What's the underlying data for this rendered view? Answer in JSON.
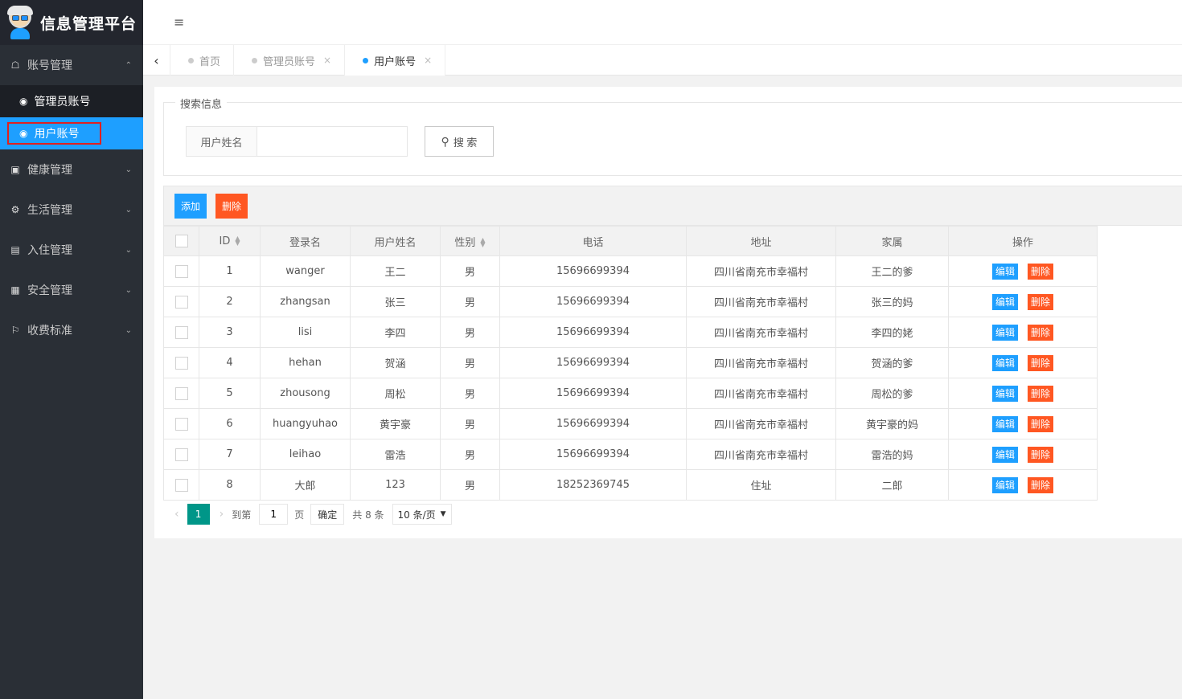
{
  "app": {
    "title": "信息管理平台"
  },
  "sidebar": {
    "groups": [
      {
        "label": "账号管理",
        "icon": "home-icon",
        "expanded": true
      },
      {
        "label": "健康管理",
        "icon": "window-icon"
      },
      {
        "label": "生活管理",
        "icon": "gears-icon"
      },
      {
        "label": "入住管理",
        "icon": "file-icon"
      },
      {
        "label": "安全管理",
        "icon": "calendar-icon"
      },
      {
        "label": "收费标准",
        "icon": "flag-icon"
      }
    ],
    "sub_items": [
      {
        "label": "管理员账号",
        "icon": "dashboard-icon"
      },
      {
        "label": "用户账号",
        "icon": "dashboard-icon",
        "active": true
      }
    ]
  },
  "tabs": [
    {
      "label": "首页"
    },
    {
      "label": "管理员账号",
      "close": "×"
    },
    {
      "label": "用户账号",
      "close": "×",
      "active": true
    }
  ],
  "search": {
    "legend": "搜索信息",
    "label": "用户姓名",
    "value": "",
    "button": "搜 索"
  },
  "toolbar": {
    "add": "添加",
    "delete": "删除"
  },
  "table": {
    "headers": [
      "ID",
      "登录名",
      "用户姓名",
      "性别",
      "电话",
      "地址",
      "家属",
      "操作"
    ],
    "edit_label": "编辑",
    "delete_label": "删除",
    "rows": [
      {
        "id": "1",
        "login": "wanger",
        "name": "王二",
        "gender": "男",
        "phone": "15696699394",
        "address": "四川省南充市幸福村",
        "family": "王二的爹"
      },
      {
        "id": "2",
        "login": "zhangsan",
        "name": "张三",
        "gender": "男",
        "phone": "15696699394",
        "address": "四川省南充市幸福村",
        "family": "张三的妈"
      },
      {
        "id": "3",
        "login": "lisi",
        "name": "李四",
        "gender": "男",
        "phone": "15696699394",
        "address": "四川省南充市幸福村",
        "family": "李四的姥"
      },
      {
        "id": "4",
        "login": "hehan",
        "name": "贺涵",
        "gender": "男",
        "phone": "15696699394",
        "address": "四川省南充市幸福村",
        "family": "贺涵的爹"
      },
      {
        "id": "5",
        "login": "zhousong",
        "name": "周松",
        "gender": "男",
        "phone": "15696699394",
        "address": "四川省南充市幸福村",
        "family": "周松的爹"
      },
      {
        "id": "6",
        "login": "huangyuhao",
        "name": "黄宇豪",
        "gender": "男",
        "phone": "15696699394",
        "address": "四川省南充市幸福村",
        "family": "黄宇豪的妈"
      },
      {
        "id": "7",
        "login": "leihao",
        "name": "雷浩",
        "gender": "男",
        "phone": "15696699394",
        "address": "四川省南充市幸福村",
        "family": "雷浩的妈"
      },
      {
        "id": "8",
        "login": "大郎",
        "name": "123",
        "gender": "男",
        "phone": "18252369745",
        "address": "住址",
        "family": "二郎"
      }
    ]
  },
  "pager": {
    "current": "1",
    "goto_label": "到第",
    "goto_value": "1",
    "page_unit": "页",
    "confirm": "确定",
    "total": "共 8 条",
    "page_size": "10 条/页"
  },
  "colors": {
    "sidebar": "#2a2f36",
    "primary": "#1e9fff",
    "danger": "#ff5722",
    "pager_active": "#009688"
  }
}
